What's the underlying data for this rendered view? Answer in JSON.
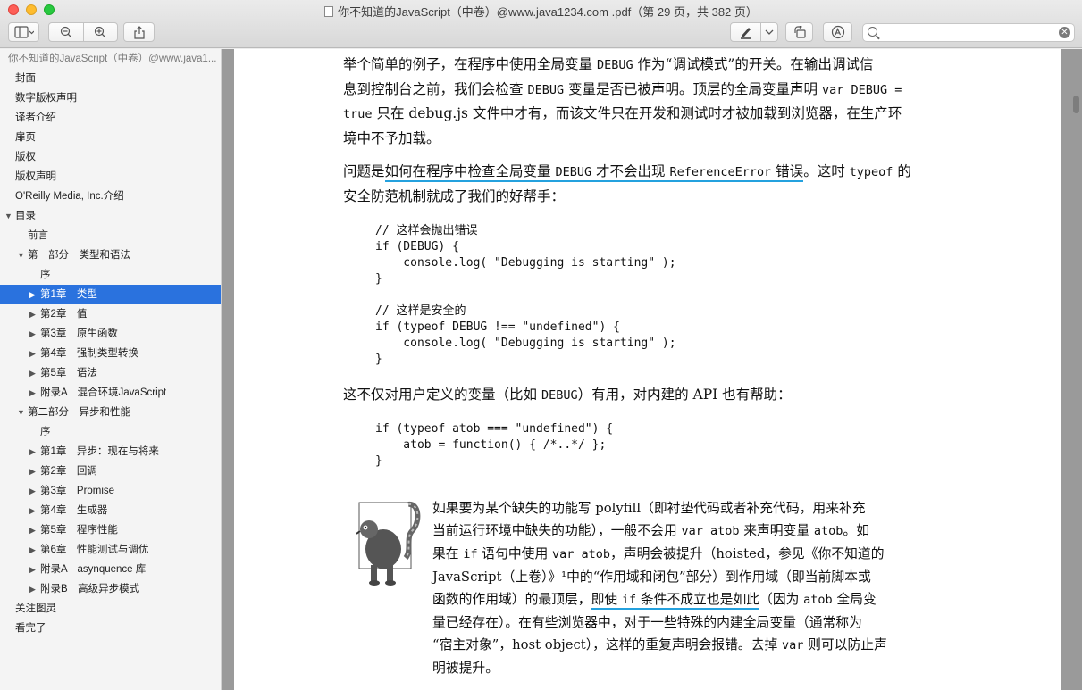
{
  "window": {
    "title": "你不知道的JavaScript（中卷）@www.java1234.com .pdf（第 29 页，共 382 页）"
  },
  "toolbar": {
    "sidebar_toggle": "sidebar-icon",
    "zoom_out": "zoom-out-icon",
    "zoom_in": "zoom-in-icon",
    "share": "share-icon",
    "markup": "pen-icon",
    "rotate": "rotate-icon",
    "annotate": "markup-icon"
  },
  "search": {
    "value": "",
    "placeholder": ""
  },
  "sidebar": {
    "heading": "你不知道的JavaScript（中卷）@www.java1...",
    "items": [
      {
        "label": "封面"
      },
      {
        "label": "数字版权声明"
      },
      {
        "label": "译者介绍"
      },
      {
        "label": "扉页"
      },
      {
        "label": "版权"
      },
      {
        "label": "版权声明"
      },
      {
        "label": "O'Reilly Media, Inc.介绍"
      },
      {
        "label": "目录"
      },
      {
        "label": "前言"
      },
      {
        "label": "第一部分　类型和语法"
      },
      {
        "label": "序"
      },
      {
        "label": "第1章　类型"
      },
      {
        "label": "第2章　值"
      },
      {
        "label": "第3章　原生函数"
      },
      {
        "label": "第4章　强制类型转换"
      },
      {
        "label": "第5章　语法"
      },
      {
        "label": "附录A　混合环境JavaScript"
      },
      {
        "label": "第二部分　异步和性能"
      },
      {
        "label": "序"
      },
      {
        "label": "第1章　异步：现在与将来"
      },
      {
        "label": "第2章　回调"
      },
      {
        "label": "第3章　Promise"
      },
      {
        "label": "第4章　生成器"
      },
      {
        "label": "第5章　程序性能"
      },
      {
        "label": "第6章　性能测试与调优"
      },
      {
        "label": "附录A　asynquence 库"
      },
      {
        "label": "附录B　高级异步模式"
      },
      {
        "label": "关注图灵"
      },
      {
        "label": "看完了"
      }
    ]
  },
  "page": {
    "p1": [
      "举个简单的例子，在程序中使用全局变量 ",
      "DEBUG",
      " 作为“调试模式”的开关。在输出调试信",
      "息到控制台之前，我们会检查 ",
      "DEBUG",
      " 变量是否已被声明。顶层的全局变量声明 ",
      "var DEBUG =",
      "true",
      " 只在 debug.js 文件中才有，而该文件只在开发和测试时才被加载到浏览器，在生产环",
      "境中不予加载。"
    ],
    "p2": [
      "问题是",
      "如何在程序中检查全局变量 ",
      "DEBUG",
      " 才不会出现 ",
      "ReferenceError",
      " 错误",
      "。这时 ",
      "typeof",
      " 的",
      "安全防范机制就成了我们的好帮手："
    ],
    "code1": [
      "// 这样会抛出错误",
      "if (DEBUG) {",
      "    console.log( \"Debugging is starting\" );",
      "}",
      "",
      "// 这样是安全的",
      "if (typeof DEBUG !== \"undefined\") {",
      "    console.log( \"Debugging is starting\" );",
      "}"
    ],
    "p3": [
      "这不仅对用户定义的变量（比如 ",
      "DEBUG",
      "）有用，对内建的 API 也有帮助："
    ],
    "code2": [
      "if (typeof atob === \"undefined\") {",
      "    atob = function() { /*..*/ };",
      "}"
    ],
    "note": {
      "icon": "lemur-icon",
      "l1": "如果要为某个缺失的功能写 polyfill（即衬垫代码或者补充代码，用来补充",
      "l2a": "当前运行环境中缺失的功能），一般不会用 ",
      "l2b": "var atob",
      "l2c": " 来声明变量 ",
      "l2d": "atob",
      "l2e": "。如",
      "l3a": "果在 ",
      "l3b": "if",
      "l3c": " 语句中使用 ",
      "l3d": "var atob",
      "l3e": "，声明会被提升（hoisted，参见《你不知道的",
      "l4": "JavaScript（上卷）》¹中的“作用域和闭包”部分）到作用域（即当前脚本或",
      "l5a": "函数的作用域）的最顶层，",
      "l5b": "即使 ",
      "l5c": "if",
      "l5d": " 条件不成立也是如此",
      "l5e": "（因为 ",
      "l5f": "atob",
      "l5g": " 全局变",
      "l6": "量已经存在）。在有些浏览器中，对于一些特殊的内建全局变量（通常称为",
      "l7a": "“宿主对象”，host object），这样的重复声明会报错。去掉 ",
      "l7b": "var",
      "l7c": " 则可以防止声",
      "l8": "明被提升。"
    }
  },
  "colors": {
    "selection": "#2a72de",
    "underline": "#24a1de"
  }
}
